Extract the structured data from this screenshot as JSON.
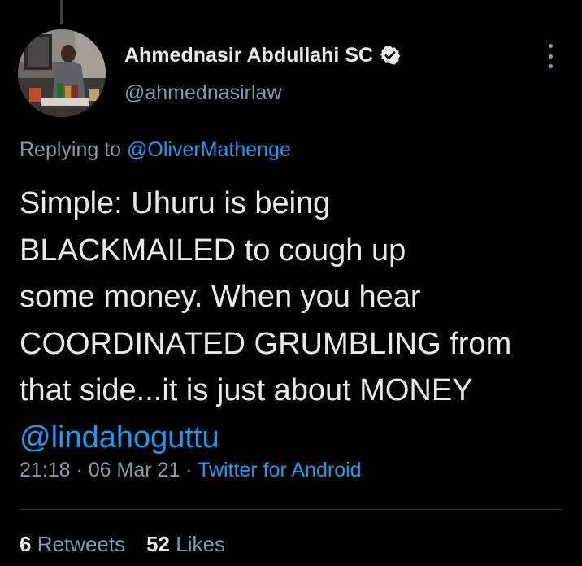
{
  "colors": {
    "background": "#000000",
    "text_primary": "#e7e9ea",
    "text_secondary": "#8b98a5",
    "link": "#1d9bf0",
    "divider": "#2f3336"
  },
  "tweet": {
    "author": {
      "display_name": "Ahmednasir Abdullahi SC",
      "handle": "@ahmednasirlaw",
      "verified_icon": "verified-badge-icon",
      "avatar_icon": "avatar-photo"
    },
    "replying_to": {
      "prefix": "Replying to ",
      "handle": "@OliverMathenge"
    },
    "body_lines": [
      "Simple: Uhuru is being",
      "BLACKMAILED to cough up",
      "some money. When you hear",
      "COORDINATED GRUMBLING from",
      "that side...it is just about MONEY"
    ],
    "mention": "@lindahoguttu",
    "time": "21:18",
    "separator": " · ",
    "date": "06 Mar 21",
    "source": "Twitter for Android",
    "retweets": {
      "count": "6",
      "label": "Retweets"
    },
    "likes": {
      "count": "52",
      "label": "Likes"
    },
    "more_icon": "more-vertical-icon"
  }
}
